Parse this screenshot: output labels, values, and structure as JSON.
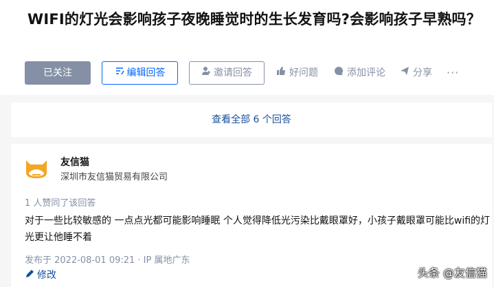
{
  "question": {
    "title": "WIFI的灯光会影响孩子夜晚睡觉时的生长发育吗?会影响孩子早熟吗？"
  },
  "actions": {
    "followed": "已关注",
    "edit_answer": "编辑回答",
    "invite_answer": "邀请回答",
    "good_question": "好问题",
    "add_comment": "添加评论",
    "share": "分享",
    "more": "···"
  },
  "view_all": "查看全部 6 个回答",
  "answer": {
    "author_name": "友信猫",
    "author_headline": "深圳市友信猫贸易有限公司",
    "vote_info": "1 人赞同了该回答",
    "content": "对于一些比较敏感的 一点点光都可能影响睡眠 个人觉得降低光污染比戴眼罩好，小孩子戴眼罩可能比wifi的灯光更让他睡不着",
    "meta": "发布于 2022-08-01 09:21 · IP 属地广东",
    "edit": "修改"
  },
  "watermark": "头条 @友信猫",
  "colors": {
    "primary": "#0066ff",
    "muted": "#8590a6",
    "link": "#175199",
    "avatar_orange": "#f5a623"
  },
  "icons": [
    "edit-lines-icon",
    "invite-user-icon",
    "thumb-up-icon",
    "comment-icon",
    "share-plane-icon",
    "pencil-icon",
    "cat-logo-icon"
  ]
}
